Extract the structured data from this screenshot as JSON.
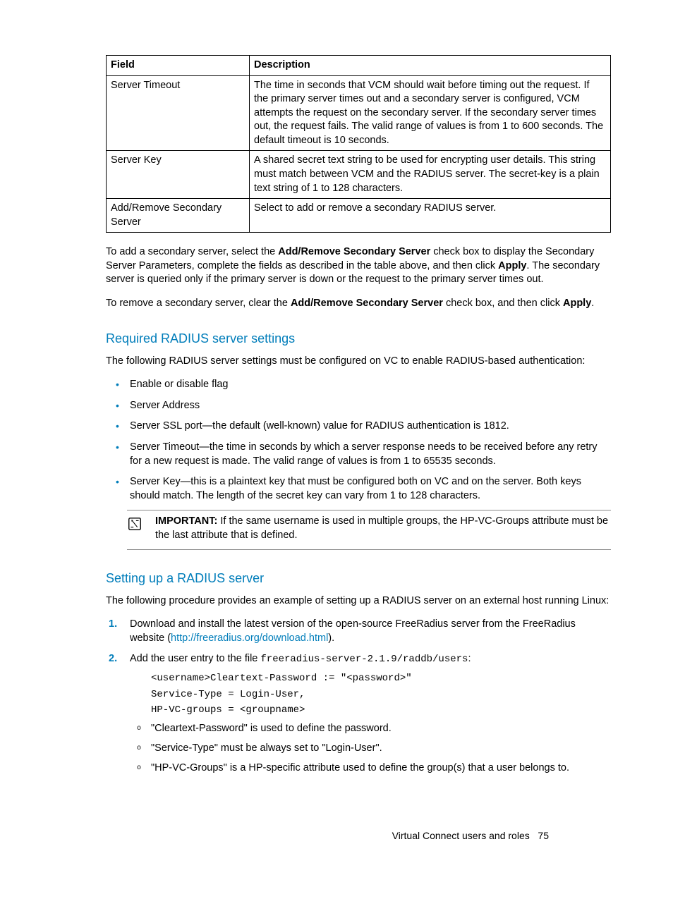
{
  "table": {
    "headers": {
      "field": "Field",
      "desc": "Description"
    },
    "rows": [
      {
        "field": "Server Timeout",
        "desc": "The time in seconds that VCM should wait before timing out the request. If the primary server times out and a secondary server is configured, VCM attempts the request on the secondary server. If the secondary server times out, the request fails. The valid range of values is from 1 to 600 seconds. The default timeout is 10 seconds."
      },
      {
        "field": "Server Key",
        "desc": "A shared secret text string to be used for encrypting user details. This string must match between VCM and the RADIUS server. The secret-key is a plain text string of 1 to 128 characters."
      },
      {
        "field": "Add/Remove Secondary Server",
        "desc": "Select to add or remove a secondary RADIUS server."
      }
    ]
  },
  "p1": {
    "a": "To add a secondary server, select the ",
    "b": "Add/Remove Secondary Server",
    "c": " check box to display the Secondary Server Parameters, complete the fields as described in the table above, and then click ",
    "d": "Apply",
    "e": ". The secondary server is queried only if the primary server is down or the request to the primary server times out."
  },
  "p2": {
    "a": "To remove a secondary server, clear the ",
    "b": "Add/Remove Secondary Server",
    "c": " check box, and then click ",
    "d": "Apply",
    "e": "."
  },
  "h_required": "Required RADIUS server settings",
  "req_intro": "The following RADIUS server settings must be configured on VC to enable RADIUS-based authentication:",
  "req_items": [
    "Enable or disable flag",
    "Server Address",
    "Server SSL port—the default (well-known) value for RADIUS authentication is 1812.",
    "Server Timeout—the time in seconds by which a server response needs to be received before any retry for a new request is made. The valid range of values is from 1 to 65535 seconds.",
    "Server Key—this is a plaintext key that must be configured both on VC and on the server. Both keys should match. The length of the secret key can vary from 1 to 128 characters."
  ],
  "important": {
    "label": "IMPORTANT:",
    "text": "  If the same username is used in multiple groups, the HP-VC-Groups attribute must be the last attribute that is defined."
  },
  "h_setup": "Setting up a RADIUS server",
  "setup_intro": "The following procedure provides an example of setting up a RADIUS server on an external host running Linux:",
  "step1": {
    "a": "Download and install the latest version of the open-source FreeRadius server from the FreeRadius website (",
    "link": "http://freeradius.org/download.html",
    "b": ")."
  },
  "step2": {
    "a": "Add the user entry to the file ",
    "path": "freeradius-server-2.1.9/raddb/users",
    "b": ":",
    "code1": "<username>Cleartext-Password := \"<password>\"",
    "code2": "Service-Type = Login-User,",
    "code3": "HP-VC-groups = <groupname>",
    "sub": [
      "\"Cleartext-Password\" is used to define the password.",
      "\"Service-Type\" must be always set to \"Login-User\".",
      "\"HP-VC-Groups\" is a HP-specific attribute used to define the group(s) that a user belongs to."
    ]
  },
  "footer": {
    "section": "Virtual Connect users and roles",
    "page": "75"
  }
}
